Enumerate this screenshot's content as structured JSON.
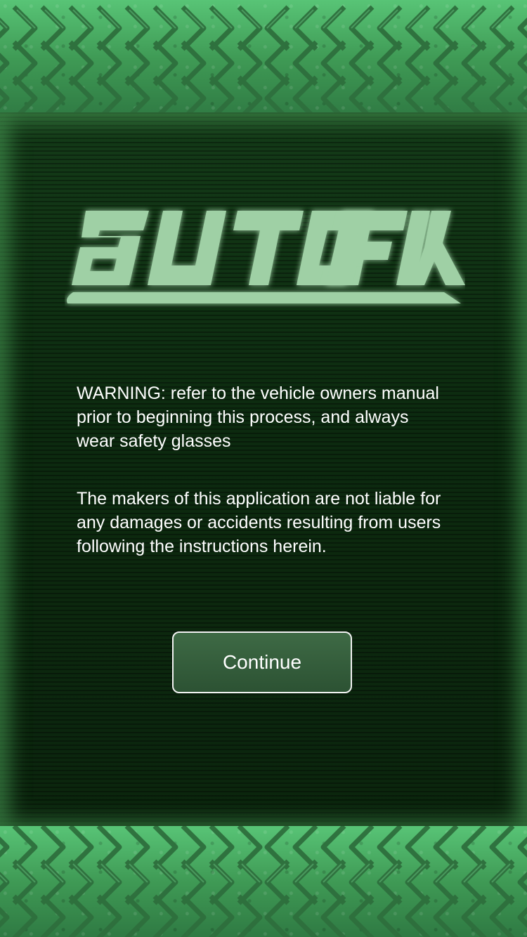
{
  "app": {
    "logo_text": "AUTO FIX"
  },
  "notice": {
    "warning": "WARNING: refer to the vehicle owners manual prior to beginning this process, and always wear safety glasses",
    "disclaimer": "The makers of this application are not liable for any damages or accidents resulting from users following the instructions herein."
  },
  "actions": {
    "continue_label": "Continue"
  },
  "colors": {
    "tread_green": "#3f9a55",
    "panel_dark_green": "#0d2910",
    "logo_mint": "#9fd3a8",
    "text_white": "#ffffff"
  }
}
